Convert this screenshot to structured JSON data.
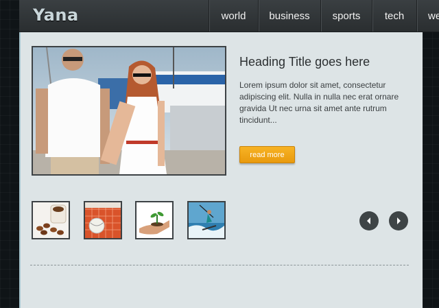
{
  "header": {
    "logo": "Yana",
    "nav": [
      "world",
      "business",
      "sports",
      "tech",
      "we"
    ]
  },
  "feature": {
    "heading": "Heading Title goes here",
    "body": "Lorem ipsum dolor sit amet, consectetur adipiscing elit. Nulla in nulla nec erat ornare gravida Ut nec urna sit amet ante rutrum tincidunt...",
    "button_label": "read more",
    "hero_image": "couple-at-marina-photo"
  },
  "thumbnails": [
    {
      "name": "coffee-beans-thumbnail"
    },
    {
      "name": "tennis-ball-thumbnail"
    },
    {
      "name": "plant-in-hand-thumbnail"
    },
    {
      "name": "surfer-thumbnail"
    }
  ],
  "slider": {
    "prev_icon": "chevron-left-icon",
    "next_icon": "chevron-right-icon"
  },
  "colors": {
    "accent": "#f2a81c",
    "header": "#2f3335",
    "panel": "#dde4e6"
  }
}
